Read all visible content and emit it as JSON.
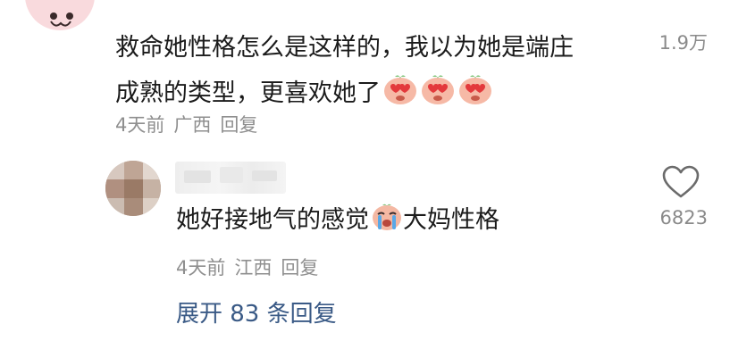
{
  "comment": {
    "text_line1": "救命她性格怎么是这样的，我以为她是端庄",
    "text_line2": "成熟的类型，更喜欢她了",
    "emojis": [
      "heart-eyes-emoji",
      "heart-eyes-emoji",
      "heart-eyes-emoji"
    ],
    "likes": "1.9万",
    "time": "4天前",
    "location": "广西",
    "reply_label": "回复"
  },
  "reply": {
    "text_before": "她好接地气的感觉",
    "emoji": "crying-emoji",
    "text_after": "大妈性格",
    "likes": "6823",
    "time": "4天前",
    "location": "江西",
    "reply_label": "回复"
  },
  "expand_label": "展开 83 条回复",
  "colors": {
    "text": "#1b1b1b",
    "meta": "#8f8f8f",
    "link": "#3a5a86",
    "avatar_pink": "#f9dadd"
  }
}
